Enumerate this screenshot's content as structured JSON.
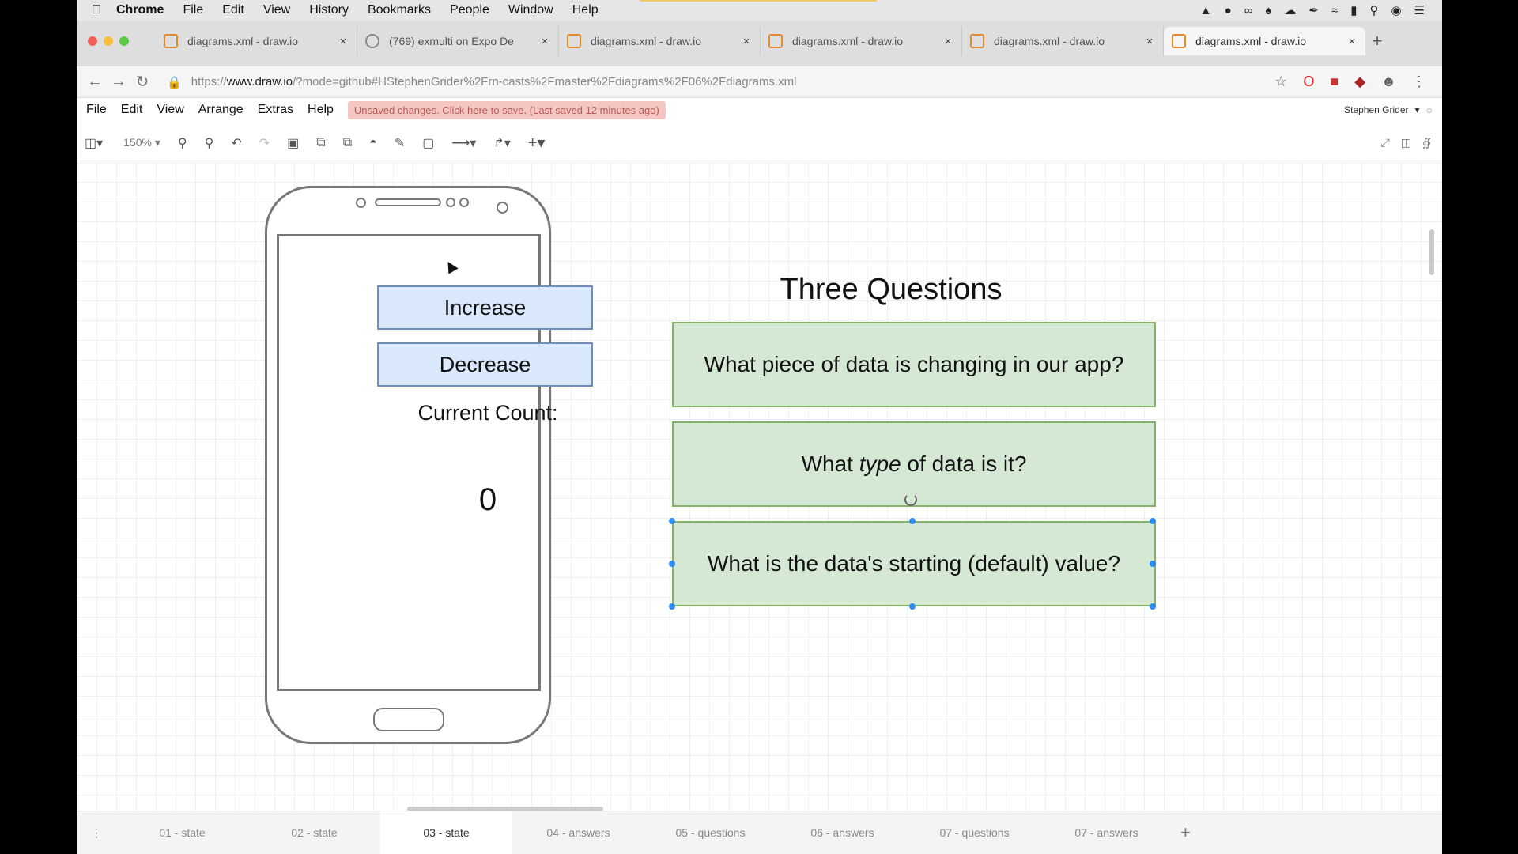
{
  "menubar": {
    "app": "Chrome",
    "items": [
      "File",
      "Edit",
      "View",
      "History",
      "Bookmarks",
      "People",
      "Window",
      "Help"
    ]
  },
  "tabs": [
    {
      "title": "diagrams.xml - draw.io",
      "icon": "drawio-icon"
    },
    {
      "title": "(769) exmulti on Expo De",
      "icon": "github-icon"
    },
    {
      "title": "diagrams.xml - draw.io",
      "icon": "drawio-icon"
    },
    {
      "title": "diagrams.xml - draw.io",
      "icon": "drawio-icon"
    },
    {
      "title": "diagrams.xml - draw.io",
      "icon": "drawio-icon"
    },
    {
      "title": "diagrams.xml - draw.io",
      "icon": "drawio-icon",
      "active": true
    }
  ],
  "address": {
    "prefix": "https://",
    "domain": "www.draw.io",
    "path": "/?mode=github#HStephenGrider%2Frn-casts%2Fmaster%2Fdiagrams%2F06%2Fdiagrams.xml"
  },
  "appmenu": {
    "items": [
      "File",
      "Edit",
      "View",
      "Arrange",
      "Extras",
      "Help"
    ],
    "unsaved": "Unsaved changes. Click here to save. (Last saved 12 minutes ago)",
    "user": "Stephen Grider"
  },
  "toolbar": {
    "zoom": "150%"
  },
  "diagram": {
    "increase": "Increase",
    "decrease": "Decrease",
    "count_label": "Current Count:",
    "count_value": "0",
    "title": "Three Questions",
    "q1": "What piece of data is changing in our app?",
    "q2_pre": "What ",
    "q2_em": "type",
    "q2_post": " of data is it?",
    "q3": "What is the data's starting (default) value?"
  },
  "pages": [
    "01 - state",
    "02 - state",
    "03 - state",
    "04 - answers",
    "05 - questions",
    "06 - answers",
    "07 - questions",
    "07 - answers"
  ],
  "active_page": "03 - state",
  "colors": {
    "button_fill": "#dae8fc",
    "button_stroke": "#6c8ebf",
    "question_fill": "#d5e8d4",
    "question_stroke": "#82b366",
    "selection": "#2b8ff3",
    "unsaved_bg": "#f4c7c3"
  }
}
